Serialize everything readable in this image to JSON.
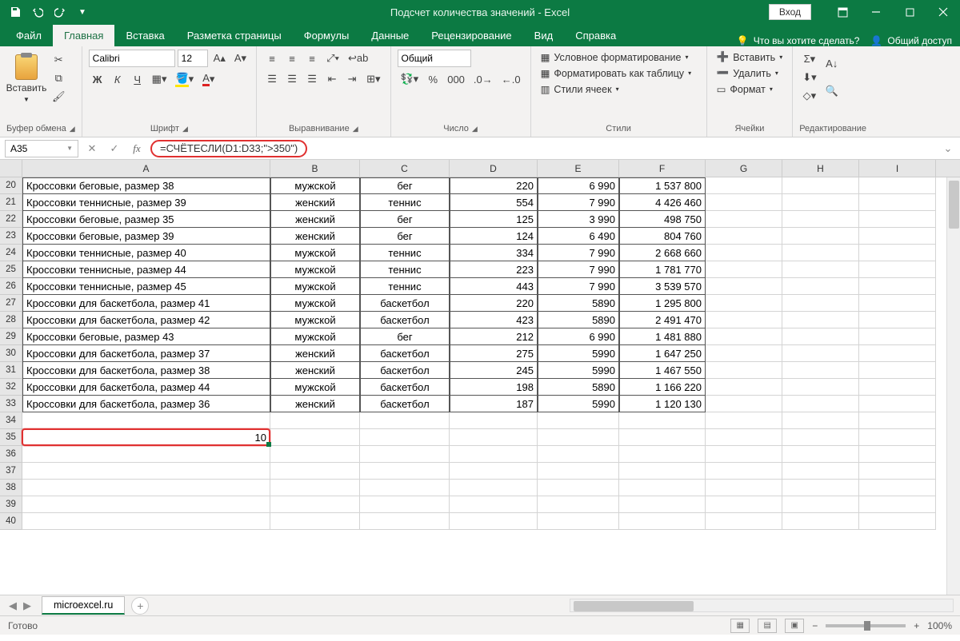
{
  "title": "Подсчет количества значений  -  Excel",
  "login": "Вход",
  "tabs": [
    "Файл",
    "Главная",
    "Вставка",
    "Разметка страницы",
    "Формулы",
    "Данные",
    "Рецензирование",
    "Вид",
    "Справка"
  ],
  "active_tab": 1,
  "tellme": "Что вы хотите сделать?",
  "share": "Общий доступ",
  "ribbon": {
    "clipboard": {
      "paste": "Вставить",
      "label": "Буфер обмена"
    },
    "font": {
      "name": "Calibri",
      "size": "12",
      "label": "Шрифт",
      "bold": "Ж",
      "italic": "К",
      "underline": "Ч"
    },
    "align": {
      "label": "Выравнивание"
    },
    "number": {
      "format": "Общий",
      "label": "Число"
    },
    "styles": {
      "cond": "Условное форматирование",
      "as_table": "Форматировать как таблицу",
      "cell_styles": "Стили ячеек",
      "label": "Стили"
    },
    "cells": {
      "insert": "Вставить",
      "delete": "Удалить",
      "format": "Формат",
      "label": "Ячейки"
    },
    "editing": {
      "label": "Редактирование"
    }
  },
  "namebox": "A35",
  "formula": "=СЧЁТЕСЛИ(D1:D33;\">350\")",
  "columns": [
    "A",
    "B",
    "C",
    "D",
    "E",
    "F",
    "G",
    "H",
    "I"
  ],
  "col_classes": [
    "cw-A",
    "cw-B",
    "cw-C",
    "cw-D",
    "cw-E",
    "cw-F",
    "cw-G",
    "cw-H",
    "cw-I"
  ],
  "rows": [
    {
      "n": 20,
      "a": "Кроссовки беговые, размер 38",
      "b": "мужской",
      "c": "бег",
      "d": "220",
      "e": "6 990",
      "f": "1 537 800"
    },
    {
      "n": 21,
      "a": "Кроссовки теннисные, размер 39",
      "b": "женский",
      "c": "теннис",
      "d": "554",
      "e": "7 990",
      "f": "4 426 460"
    },
    {
      "n": 22,
      "a": "Кроссовки беговые, размер 35",
      "b": "женский",
      "c": "бег",
      "d": "125",
      "e": "3 990",
      "f": "498 750"
    },
    {
      "n": 23,
      "a": "Кроссовки беговые, размер 39",
      "b": "женский",
      "c": "бег",
      "d": "124",
      "e": "6 490",
      "f": "804 760"
    },
    {
      "n": 24,
      "a": "Кроссовки теннисные, размер 40",
      "b": "мужской",
      "c": "теннис",
      "d": "334",
      "e": "7 990",
      "f": "2 668 660"
    },
    {
      "n": 25,
      "a": "Кроссовки теннисные, размер 44",
      "b": "мужской",
      "c": "теннис",
      "d": "223",
      "e": "7 990",
      "f": "1 781 770"
    },
    {
      "n": 26,
      "a": "Кроссовки теннисные, размер 45",
      "b": "мужской",
      "c": "теннис",
      "d": "443",
      "e": "7 990",
      "f": "3 539 570"
    },
    {
      "n": 27,
      "a": "Кроссовки для баскетбола, размер 41",
      "b": "мужской",
      "c": "баскетбол",
      "d": "220",
      "e": "5890",
      "f": "1 295 800"
    },
    {
      "n": 28,
      "a": "Кроссовки для баскетбола, размер 42",
      "b": "мужской",
      "c": "баскетбол",
      "d": "423",
      "e": "5890",
      "f": "2 491 470"
    },
    {
      "n": 29,
      "a": "Кроссовки беговые, размер 43",
      "b": "мужской",
      "c": "бег",
      "d": "212",
      "e": "6 990",
      "f": "1 481 880"
    },
    {
      "n": 30,
      "a": "Кроссовки для баскетбола, размер 37",
      "b": "женский",
      "c": "баскетбол",
      "d": "275",
      "e": "5990",
      "f": "1 647 250"
    },
    {
      "n": 31,
      "a": "Кроссовки для баскетбола, размер 38",
      "b": "женский",
      "c": "баскетбол",
      "d": "245",
      "e": "5990",
      "f": "1 467 550"
    },
    {
      "n": 32,
      "a": "Кроссовки для баскетбола, размер 44",
      "b": "мужской",
      "c": "баскетбол",
      "d": "198",
      "e": "5890",
      "f": "1 166 220"
    },
    {
      "n": 33,
      "a": "Кроссовки для баскетбола, размер 36",
      "b": "женский",
      "c": "баскетбол",
      "d": "187",
      "e": "5990",
      "f": "1 120 130"
    }
  ],
  "empty_rows": [
    34,
    35,
    36,
    37,
    38,
    39,
    40
  ],
  "result_row": 35,
  "result_value": "10",
  "sheet_tab": "microexcel.ru",
  "status": "Готово",
  "zoom": "100%"
}
